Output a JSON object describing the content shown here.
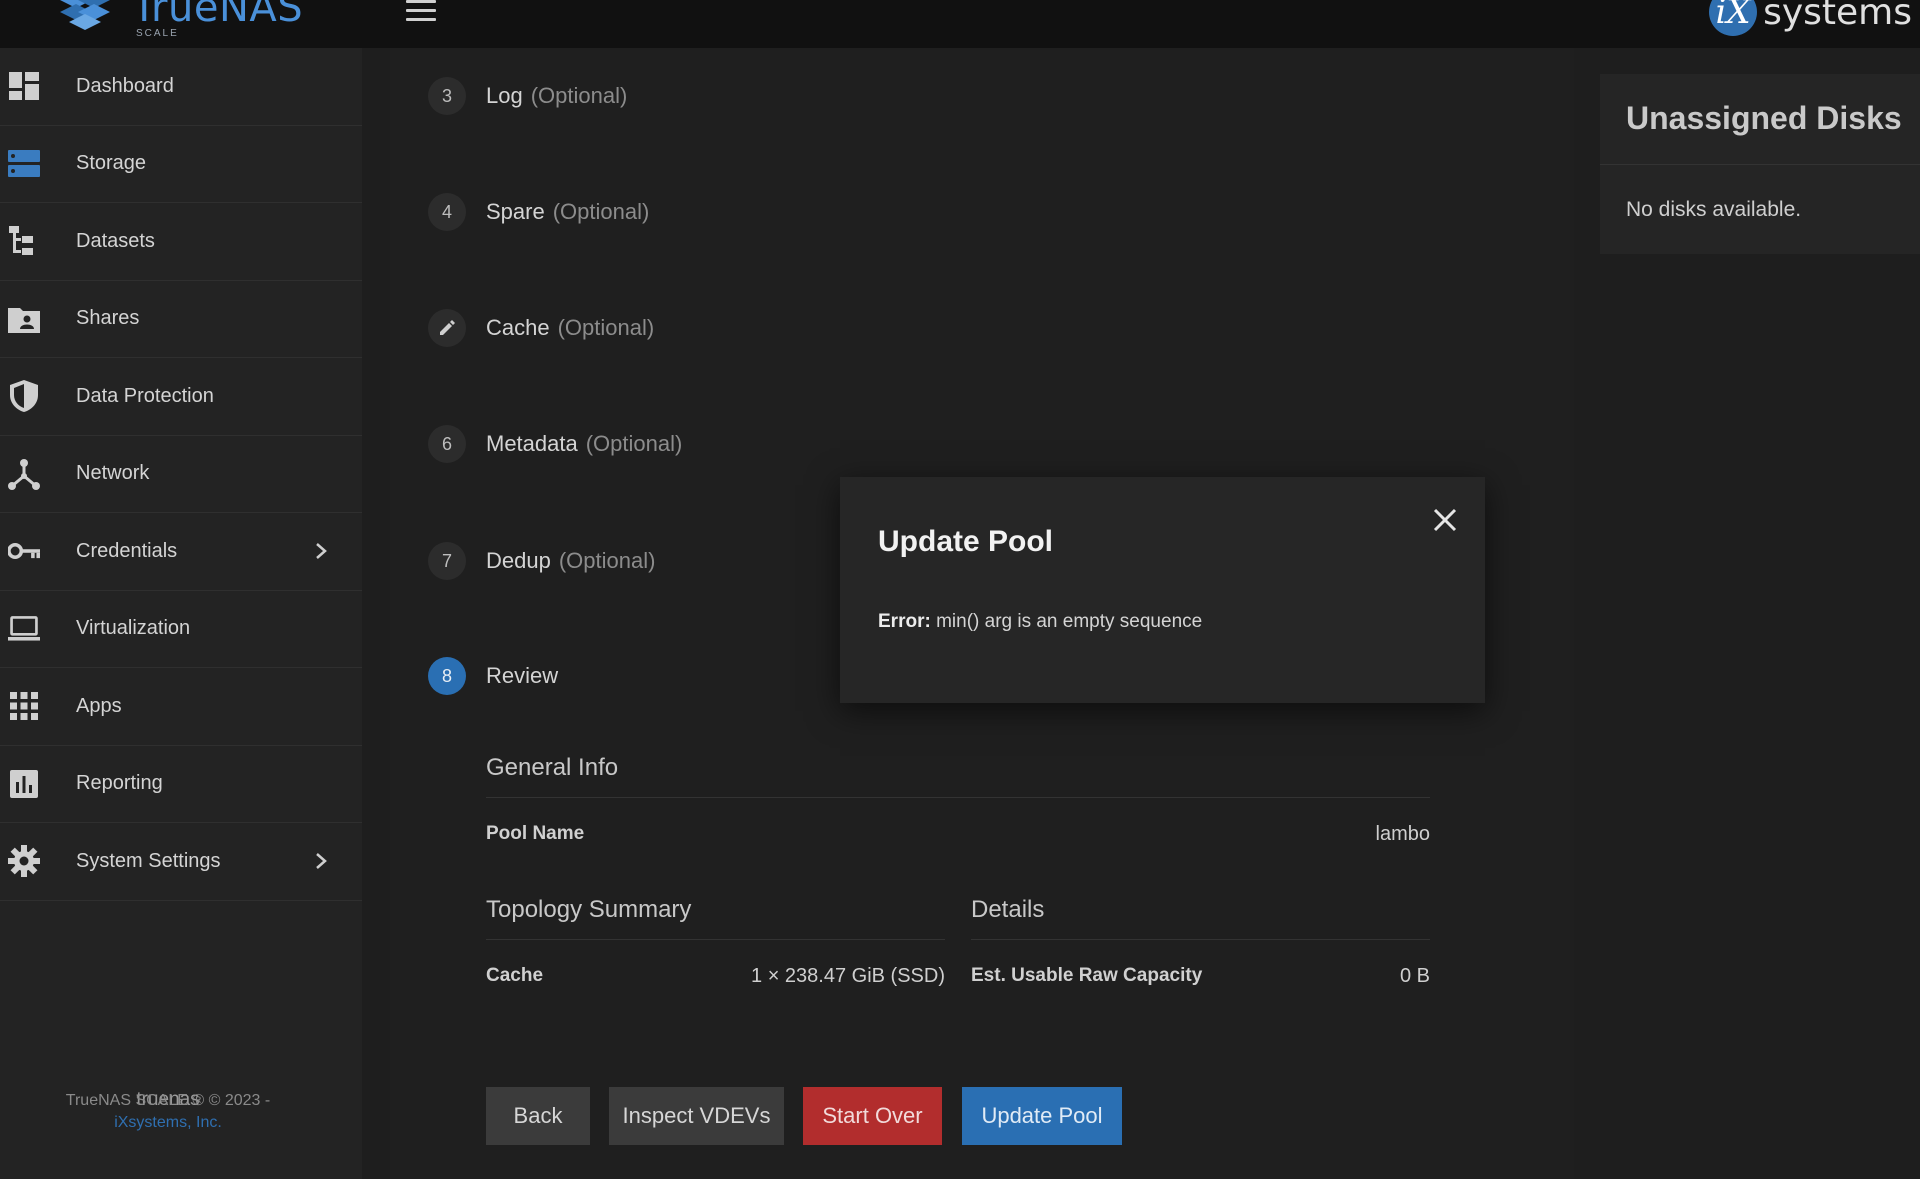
{
  "app": {
    "brand": "TrueNAS",
    "edition": "SCALE",
    "vendor": "systems",
    "vendor_mark": "iX"
  },
  "sidebar": {
    "items": [
      {
        "label": "Dashboard",
        "icon": "dashboard-icon"
      },
      {
        "label": "Storage",
        "icon": "storage-icon",
        "active": true
      },
      {
        "label": "Datasets",
        "icon": "datasets-icon"
      },
      {
        "label": "Shares",
        "icon": "shares-icon"
      },
      {
        "label": "Data Protection",
        "icon": "shield-icon"
      },
      {
        "label": "Network",
        "icon": "network-icon"
      },
      {
        "label": "Credentials",
        "icon": "key-icon",
        "has_submenu": true
      },
      {
        "label": "Virtualization",
        "icon": "laptop-icon"
      },
      {
        "label": "Apps",
        "icon": "apps-grid-icon"
      },
      {
        "label": "Reporting",
        "icon": "bar-chart-icon"
      },
      {
        "label": "System Settings",
        "icon": "gear-icon",
        "has_submenu": true
      }
    ],
    "hostname": "truenas",
    "copyright": "TrueNAS SCALE ® © 2023 -",
    "company": "iXsystems, Inc."
  },
  "wizard": {
    "steps": [
      {
        "num": "3",
        "label": "Log",
        "optional": "(Optional)"
      },
      {
        "num": "4",
        "label": "Spare",
        "optional": "(Optional)"
      },
      {
        "num": "",
        "label": "Cache",
        "optional": "(Optional)",
        "icon": "pencil-icon"
      },
      {
        "num": "6",
        "label": "Metadata",
        "optional": "(Optional)"
      },
      {
        "num": "7",
        "label": "Dedup",
        "optional": "(Optional)"
      },
      {
        "num": "8",
        "label": "Review",
        "optional": "",
        "active": true
      }
    ],
    "review": {
      "general_info_title": "General Info",
      "pool_name_key": "Pool Name",
      "pool_name_value": "lambo",
      "topology_title": "Topology Summary",
      "cache_key": "Cache",
      "cache_value": "1 × 238.47 GiB (SSD)",
      "details_title": "Details",
      "capacity_key": "Est. Usable Raw Capacity",
      "capacity_value": "0 B"
    },
    "buttons": {
      "back": "Back",
      "inspect": "Inspect VDEVs",
      "start_over": "Start Over",
      "update_pool": "Update Pool"
    }
  },
  "unassigned": {
    "title": "Unassigned Disks",
    "message": "No disks available."
  },
  "dialog": {
    "title": "Update Pool",
    "error_label": "Error:",
    "error_message": "min() arg is an empty sequence"
  },
  "colors": {
    "accent": "#2a6fb3",
    "danger": "#b22d2d",
    "topbar": "#111111",
    "sidebar": "#232323"
  }
}
